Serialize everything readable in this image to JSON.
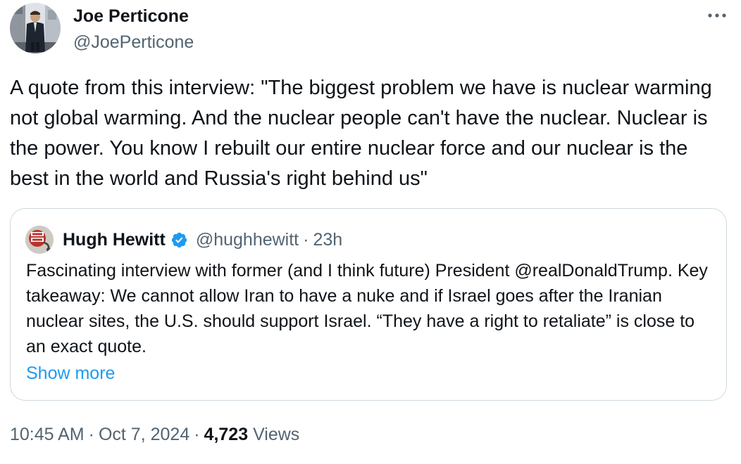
{
  "author": {
    "name": "Joe Perticone",
    "handle": "@JoePerticone"
  },
  "tweet": {
    "text": "A quote from this interview: \"The biggest problem we have is nuclear warming not global warming. And the nuclear people can't have the nuclear. Nuclear is the power. You know I rebuilt our entire nuclear force and our nuclear is the best in the world and Russia's right behind us\""
  },
  "quoted": {
    "name": "Hugh Hewitt",
    "handle": "@hughhewitt",
    "separator": "·",
    "time": "23h",
    "verified": true,
    "text": "Fascinating interview with former (and I think future) President @realDonaldTrump. Key takeaway: We cannot allow Iran to have a nuke and if Israel goes after the Iranian nuclear sites, the U.S. should support Israel. “They have a right to retaliate” is close to an exact quote.",
    "show_more": "Show more"
  },
  "meta": {
    "time": "10:45 AM",
    "date": "Oct 7, 2024",
    "separator": "·",
    "views_count": "4,723",
    "views_label": "Views"
  },
  "icons": {
    "more": "more-horizontal-icon",
    "verified": "verified-badge-icon"
  },
  "colors": {
    "link": "#1d9bf0",
    "secondary_text": "#536471",
    "border": "#cfd9de",
    "text": "#0f1419"
  }
}
